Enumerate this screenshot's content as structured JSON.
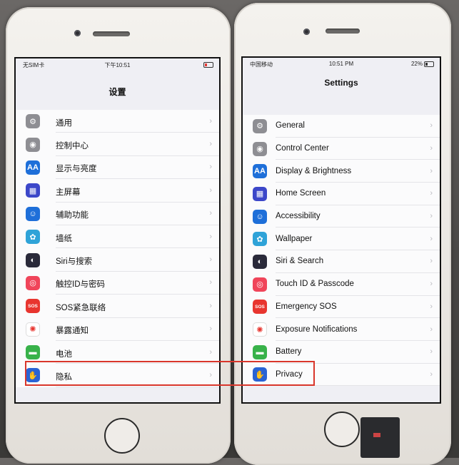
{
  "left_phone": {
    "status": {
      "carrier": "无SIM卡",
      "time": "下午10:51"
    },
    "title": "设置",
    "items": [
      {
        "label": "通用",
        "icon": "gear-icon",
        "color": "#8e8e93"
      },
      {
        "label": "控制中心",
        "icon": "toggles-icon",
        "color": "#8e8e93"
      },
      {
        "label": "显示与亮度",
        "icon": "text-size-icon",
        "color": "#1e6fd9"
      },
      {
        "label": "主屏幕",
        "icon": "grid-icon",
        "color": "#3c47c9"
      },
      {
        "label": "辅助功能",
        "icon": "accessibility-icon",
        "color": "#1e6fd9"
      },
      {
        "label": "墙纸",
        "icon": "flower-icon",
        "color": "#2fa3d8"
      },
      {
        "label": "Siri与搜索",
        "icon": "siri-icon",
        "color": "#2a2a3a"
      },
      {
        "label": "触控ID与密码",
        "icon": "fingerprint-icon",
        "color": "#f0455a"
      },
      {
        "label": "SOS紧急联络",
        "icon": "sos-icon",
        "color": "#e8352f"
      },
      {
        "label": "暴露通知",
        "icon": "exposure-icon",
        "color": "#ffffff"
      },
      {
        "label": "电池",
        "icon": "battery-icon",
        "color": "#38b24a"
      },
      {
        "label": "隐私",
        "icon": "hand-icon",
        "color": "#2a63d4"
      }
    ]
  },
  "right_phone": {
    "status": {
      "carrier": "中国移动",
      "time": "10:51 PM",
      "battery": "22%"
    },
    "title": "Settings",
    "items": [
      {
        "label": "General",
        "icon": "gear-icon",
        "color": "#8e8e93"
      },
      {
        "label": "Control Center",
        "icon": "toggles-icon",
        "color": "#8e8e93"
      },
      {
        "label": "Display & Brightness",
        "icon": "text-size-icon",
        "color": "#1e6fd9"
      },
      {
        "label": "Home Screen",
        "icon": "grid-icon",
        "color": "#3c47c9"
      },
      {
        "label": "Accessibility",
        "icon": "accessibility-icon",
        "color": "#1e6fd9"
      },
      {
        "label": "Wallpaper",
        "icon": "flower-icon",
        "color": "#2fa3d8"
      },
      {
        "label": "Siri & Search",
        "icon": "siri-icon",
        "color": "#2a2a3a"
      },
      {
        "label": "Touch ID & Passcode",
        "icon": "fingerprint-icon",
        "color": "#f0455a"
      },
      {
        "label": "Emergency SOS",
        "icon": "sos-icon",
        "color": "#e8352f"
      },
      {
        "label": "Exposure Notifications",
        "icon": "exposure-icon",
        "color": "#ffffff"
      },
      {
        "label": "Battery",
        "icon": "battery-icon",
        "color": "#38b24a"
      },
      {
        "label": "Privacy",
        "icon": "hand-icon",
        "color": "#2a63d4"
      }
    ]
  },
  "highlight_color": "#d9362b"
}
